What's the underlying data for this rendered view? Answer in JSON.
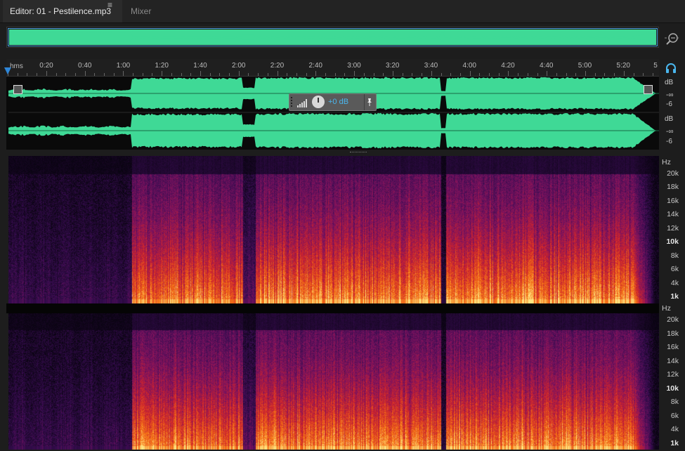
{
  "tabs": {
    "editor": "Editor: 01 - Pestilence.mp3",
    "menu_glyph": "≡",
    "mixer": "Mixer"
  },
  "colors": {
    "waveform": "#3fd996",
    "selection": "#4ea6e0",
    "playhead": "#2f87d8",
    "hud_value": "#4ab7ee",
    "background": "#1d1d1d"
  },
  "icons": {
    "tab_menu": "hamburger-icon",
    "zoom": "zoom-icon",
    "monitor": "headphones-icon",
    "pin": "pin-icon",
    "knob": "volume-knob-icon"
  },
  "ruler": {
    "unit": "hms",
    "labels": [
      "0:20",
      "0:40",
      "1:00",
      "1:20",
      "1:40",
      "2:00",
      "2:20",
      "2:40",
      "3:00",
      "3:20",
      "3:40",
      "4:00",
      "4:20",
      "4:40",
      "5:00",
      "5:20",
      "5"
    ]
  },
  "waveform": {
    "unit": "dB",
    "scale_labels": [
      "-∞",
      "-6"
    ],
    "channels": 2
  },
  "hud": {
    "value": "+0 dB",
    "pin_glyph": "📌"
  },
  "spectrogram": {
    "unit": "Hz",
    "labels": [
      "20k",
      "18k",
      "16k",
      "14k",
      "12k",
      "10k",
      "8k",
      "6k",
      "4k",
      "1k"
    ],
    "bold_labels": [
      "10k",
      "1k"
    ]
  }
}
